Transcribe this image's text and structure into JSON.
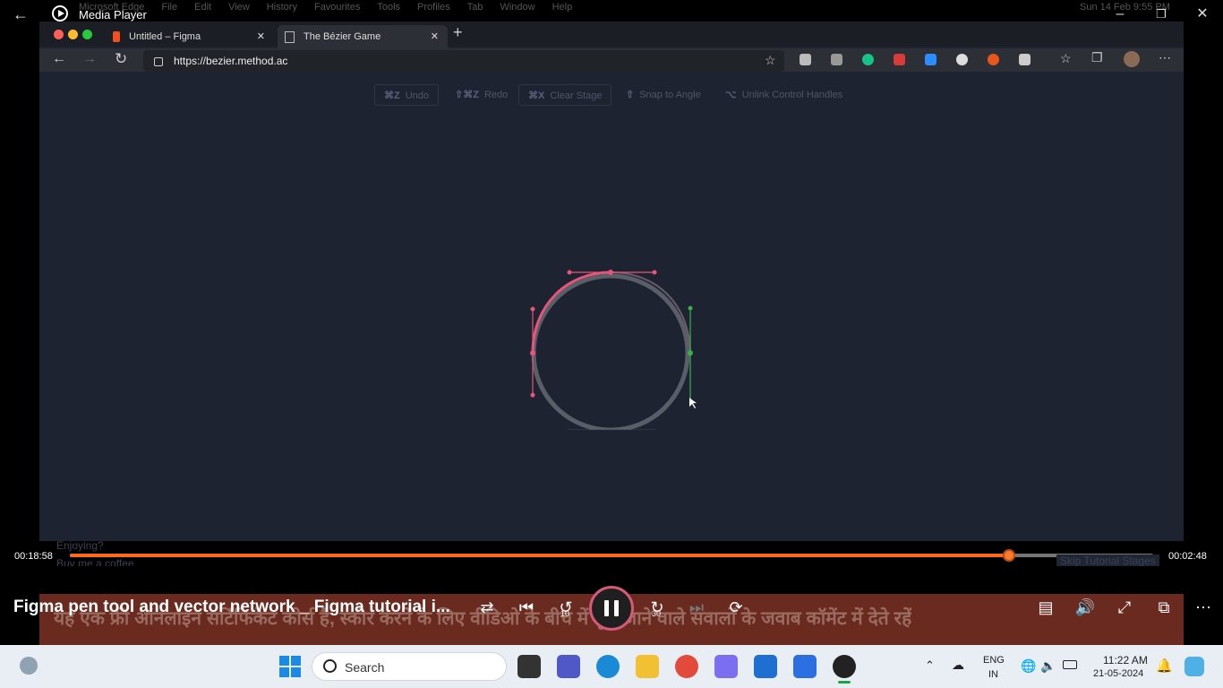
{
  "media_player": {
    "title": "Media Player",
    "video_title": "Figma pen tool and vector network _ Figma tutorial i...",
    "time_elapsed": "00:18:58",
    "time_remaining": "00:02:48",
    "progress": 0.867,
    "subtitle": "यह एक फ्री ऑनलाइन सर्टिफिकेट कोर्स है, स्कोर करने के लिए वीडिओ के बीच में पूछे जाने वाले सवालों के जवाब कॉमेंट में देते रहें",
    "controls": {
      "skip_back": "10",
      "skip_forward": "30"
    },
    "accent": "#ff6a1a"
  },
  "mac_menu": {
    "items": [
      "Microsoft Edge",
      "File",
      "Edit",
      "View",
      "History",
      "Favourites",
      "Tools",
      "Profiles",
      "Tab",
      "Window",
      "Help"
    ],
    "clock": "Sun 14 Feb  9:55 PM"
  },
  "browser": {
    "tabs": [
      {
        "label": "Untitled – Figma"
      },
      {
        "label": "The Bézier Game"
      }
    ],
    "url": "https://bezier.method.ac"
  },
  "bezier_page": {
    "toolbar": [
      {
        "key": "⌘Z",
        "label": "Undo"
      },
      {
        "key": "⇧⌘Z",
        "label": "Redo"
      },
      {
        "key": "⌘X",
        "label": "Clear Stage"
      },
      {
        "key": "⇧",
        "label": "Snap to Angle"
      },
      {
        "key": "⌥",
        "label": "Unlink Control Handles"
      }
    ],
    "enjoying": "Enjoying?",
    "buy_coffee": "Buy me a coffee",
    "skip": "Skip Tutorial Stages"
  },
  "taskbar": {
    "search_placeholder": "Search",
    "lang_top": "ENG",
    "lang_bottom": "IN",
    "time": "11:22 AM",
    "date": "21-05-2024"
  }
}
